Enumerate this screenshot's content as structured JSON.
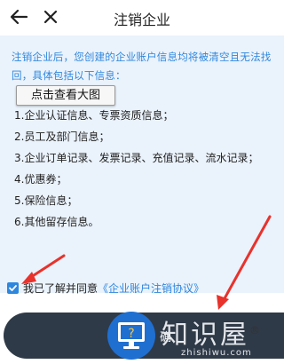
{
  "header": {
    "title": "注销企业",
    "back_icon": "back-arrow-icon",
    "close_icon": "close-icon"
  },
  "notice": {
    "intro": "注销企业后，您创建的企业账户信息均将被清空且无法找回，具体包括以下信息：",
    "tooltip": "点击查看大图",
    "items": [
      "1.企业认证信息、专票资质信息；",
      "2.员工及部门信息；",
      "3.企业订单记录、发票记录、充值记录、流水记录；",
      "4.优惠券；",
      "5.保险信息；",
      "6.其他留存信息。"
    ]
  },
  "agreement": {
    "checked": true,
    "text": "我已了解并同意",
    "link": "《企业账户注销协议》"
  },
  "submit": {
    "label": "确"
  },
  "watermark": {
    "text": "知识屋",
    "sub": "zhishiwu.com",
    "mark": "®"
  },
  "colors": {
    "accent": "#2e87de",
    "notice_bg": "#eaf2fb",
    "button_bg": "#2f3a48",
    "annotation": "#e8322c"
  }
}
